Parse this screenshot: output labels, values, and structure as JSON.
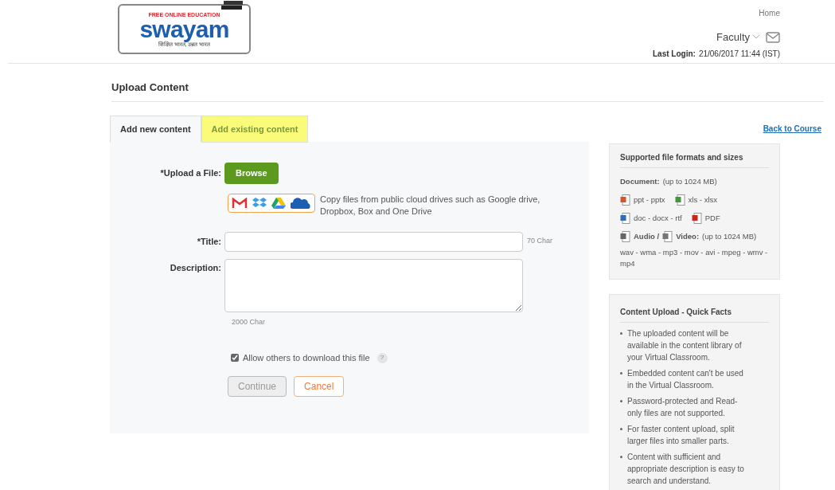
{
  "header": {
    "logo": {
      "tagline_top": "FREE ONLINE EDUCATION",
      "wordmark": "swayam",
      "tagline_bottom": "शिक्षित भारत, उन्नत भारत"
    },
    "home_link": "Home",
    "user_menu": "Faculty",
    "last_login_label": "Last Login:",
    "last_login_value": "21/06/2017 11:44 (IST)"
  },
  "page_title": "Upload Content",
  "tabs": [
    {
      "label": "Add new content",
      "selected": true,
      "highlighted": false
    },
    {
      "label": "Add existing content",
      "selected": false,
      "highlighted": true
    }
  ],
  "back_link": "Back to Course",
  "form": {
    "upload_label": "*Upload a File:",
    "browse_button": "Browse",
    "cloud_text": "Copy files from public cloud drives such as Google drive, Dropbox, Box and One Drive",
    "title_label": "*Title:",
    "title_limit": "70 Char",
    "description_label": "Description:",
    "description_limit": "2000 Char",
    "allow_download": {
      "label": "Allow others to download this file",
      "checked": true,
      "help": "?"
    },
    "continue_button": {
      "label": "Continue",
      "disabled": true
    },
    "cancel_button": "Cancel"
  },
  "formats_panel": {
    "title": "Supported file formats and sizes",
    "document_label": "Document:",
    "document_note": "(up to 1024 MB)",
    "document_rows": [
      [
        {
          "kind": "ppt",
          "text": "ppt - pptx"
        },
        {
          "kind": "xls",
          "text": "xls - xlsx"
        }
      ],
      [
        {
          "kind": "doc",
          "text": "doc - docx - rtf"
        },
        {
          "kind": "pdf",
          "text": "PDF"
        }
      ]
    ],
    "audio_label": "Audio /",
    "video_label": "Video:",
    "media_note": "(up to 1024 MB)",
    "media_formats": "wav - wma - mp3 - mov - avi - mpeg - wmv - mp4"
  },
  "facts_panel": {
    "title": "Content Upload - Quick Facts",
    "items": [
      "The uploaded content will be available in the content library of your Virtual Classroom.",
      "Embedded content can't be used in the Virtual Classroom.",
      "Password-protected and Read-only files are not supported.",
      "For faster content upload, split larger files into smaller parts.",
      "Content with sufficient and appropriate description is easy to search and understand."
    ]
  }
}
